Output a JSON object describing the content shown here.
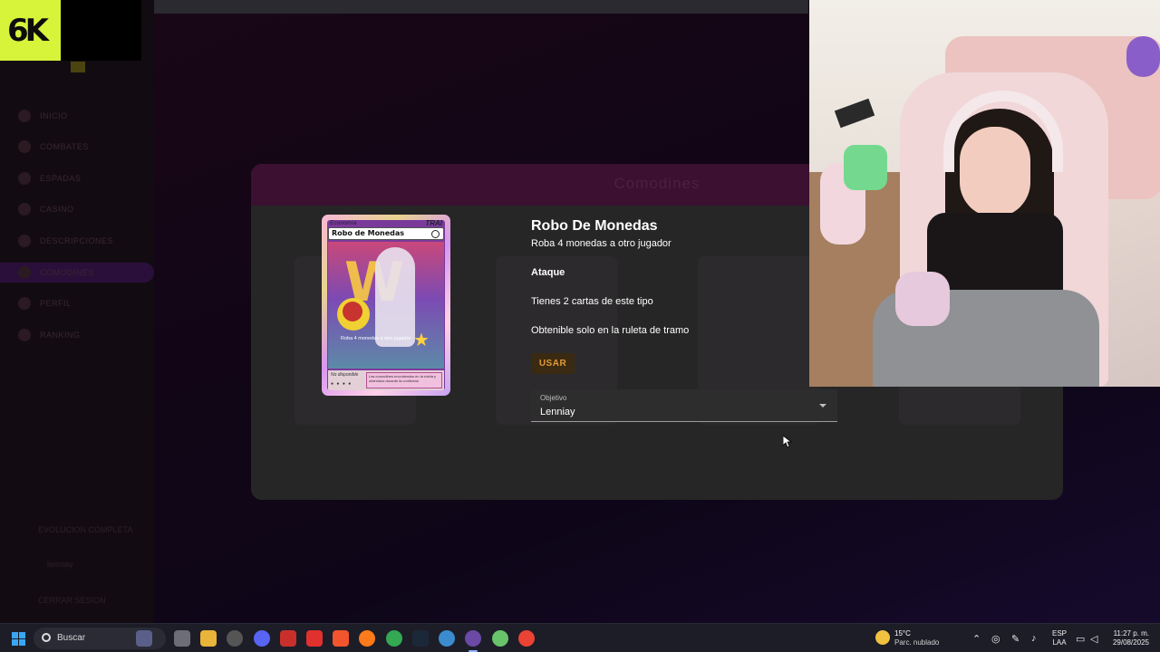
{
  "app": {
    "logo_text": "6K",
    "modal_title": "Comodines"
  },
  "sidebar": {
    "items": [
      {
        "label": "INICIO"
      },
      {
        "label": "COMBATES"
      },
      {
        "label": "ESPADAS"
      },
      {
        "label": "CASINO"
      },
      {
        "label": "DESCRIPCIONES"
      },
      {
        "label": "COMODINES"
      },
      {
        "label": "PERFIL"
      },
      {
        "label": "RANKING"
      }
    ],
    "bottom_status": "EVOLUCION COMPLETA",
    "user_name": "lenniay",
    "logout": "CERRAR SESION"
  },
  "card": {
    "category": "Economía",
    "badge": "TRAI",
    "title": "Robo de Monedas",
    "caption": "Roba 4 monedas a otro jugador",
    "footer_text": "Las comodines encontrados en la ruleta y obtenidos durante la contienda",
    "footer_label": "No disponible",
    "rarity": "● ● ● ●"
  },
  "detail": {
    "title": "Robo De Monedas",
    "description": "Roba 4 monedas a otro jugador",
    "type": "Ataque",
    "count_text": "Tienes 2 cartas de este tipo",
    "source_text": "Obtenible solo en la ruleta de tramo",
    "use_button": "USAR",
    "target_label": "Objetivo",
    "target_value": "Lenniay"
  },
  "taskbar": {
    "search_placeholder": "Buscar",
    "apps": [
      "gamepad-icon",
      "task-view-icon",
      "folder-icon",
      "chrome-icon",
      "discord-icon",
      "news-icon",
      "app-icon",
      "brave-icon",
      "firefox-icon",
      "chrome-icon",
      "steam-icon",
      "app-icon",
      "obs-icon",
      "app-icon",
      "chrome-icon"
    ],
    "weather_temp": "15°C",
    "weather_desc": "Parc. nublado",
    "lang_top": "ESP",
    "lang_bottom": "LAA",
    "time": "11:27 p. m.",
    "date": "29/08/2025"
  },
  "colors": {
    "accent": "#d7f33a",
    "use_button_text": "#e39a35",
    "modal_bg": "#262626"
  }
}
